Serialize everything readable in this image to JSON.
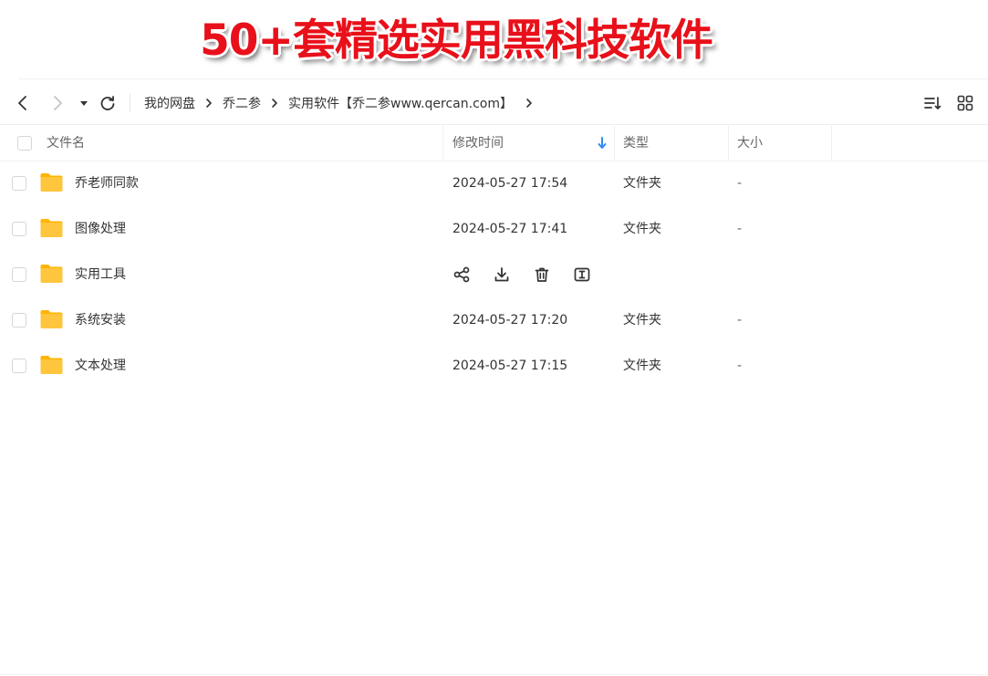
{
  "banner": {
    "text": "50+套精选实用黑科技软件"
  },
  "toolbar": {
    "back_icon": "chevron-left-icon",
    "forward_icon": "chevron-right-icon",
    "history_icon": "caret-down-icon",
    "refresh_icon": "refresh-icon",
    "breadcrumbs": [
      "我的网盘",
      "乔二参",
      "实用软件【乔二参www.qercan.com】"
    ],
    "sort_icon": "sort-list-icon",
    "grid_icon": "grid-view-icon"
  },
  "table": {
    "columns": {
      "name": "文件名",
      "modified": "修改时间",
      "type": "类型",
      "size": "大小"
    },
    "sort_indicator": "down-arrow-icon",
    "rows": [
      {
        "name": "乔老师同款",
        "modified": "2024-05-27 17:54",
        "type": "文件夹",
        "size": "-"
      },
      {
        "name": "图像处理",
        "modified": "2024-05-27 17:41",
        "type": "文件夹",
        "size": "-"
      },
      {
        "name": "实用工具",
        "modified": "",
        "type": "",
        "size": "",
        "hovered": true
      },
      {
        "name": "系统安装",
        "modified": "2024-05-27 17:20",
        "type": "文件夹",
        "size": "-"
      },
      {
        "name": "文本处理",
        "modified": "2024-05-27 17:15",
        "type": "文件夹",
        "size": "-"
      }
    ],
    "row_actions": [
      "share-icon",
      "download-icon",
      "delete-icon",
      "rename-icon"
    ]
  },
  "colors": {
    "banner_red": "#e8101a",
    "folder_yellow": "#ffc53d",
    "sort_blue": "#2d8cf0"
  }
}
